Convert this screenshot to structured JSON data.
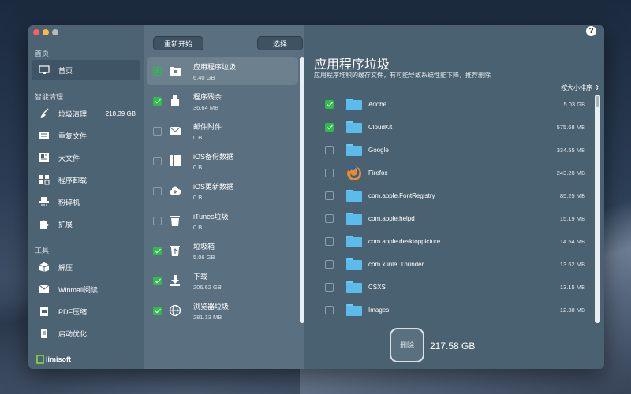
{
  "sidebar": {
    "section_home": "首页",
    "home": "首页",
    "section_smart": "智能清理",
    "items": [
      {
        "label": "垃圾清理",
        "size": "218.39 GB"
      },
      {
        "label": "重复文件"
      },
      {
        "label": "大文件"
      },
      {
        "label": "程序卸载"
      },
      {
        "label": "粉碎机"
      },
      {
        "label": "扩展"
      }
    ],
    "section_tools": "工具",
    "tools": [
      {
        "label": "解压"
      },
      {
        "label": "Winmail阅读"
      },
      {
        "label": "PDF压缩"
      },
      {
        "label": "启动优化"
      }
    ],
    "logo": "limisoft"
  },
  "toolbar": {
    "restart_label": "重新开始",
    "select_label": "选择"
  },
  "categories": [
    {
      "name": "应用程序垃圾",
      "size": "6.40 GB",
      "state": "partial"
    },
    {
      "name": "程序残余",
      "size": "36.64 MB",
      "state": "checked"
    },
    {
      "name": "邮件附件",
      "size": "0 B",
      "state": "unchecked"
    },
    {
      "name": "iOS备份数据",
      "size": "0 B",
      "state": "unchecked"
    },
    {
      "name": "iOS更新数据",
      "size": "0 B",
      "state": "unchecked"
    },
    {
      "name": "iTunes垃圾",
      "size": "0 B",
      "state": "unchecked"
    },
    {
      "name": "垃圾箱",
      "size": "5.06 GB",
      "state": "checked"
    },
    {
      "name": "下载",
      "size": "206.62 GB",
      "state": "checked"
    },
    {
      "name": "浏览器垃圾",
      "size": "281.13 MB",
      "state": "checked"
    }
  ],
  "detail": {
    "title": "应用程序垃圾",
    "description": "应用程序堆积的缓存文件，有可能导致系统性能下降，推荐删除",
    "sort_label": "按大小排序",
    "files": [
      {
        "name": "Adobe",
        "size": "5.03 GB",
        "checked": true,
        "icon": "folder-icon"
      },
      {
        "name": "CloudKit",
        "size": "575.68 MB",
        "checked": true,
        "icon": "folder-icon"
      },
      {
        "name": "Google",
        "size": "334.55 MB",
        "checked": false,
        "icon": "folder-icon"
      },
      {
        "name": "Firefox",
        "size": "243.20 MB",
        "checked": false,
        "icon": "firefox-icon"
      },
      {
        "name": "com.apple.FontRegistry",
        "size": "85.25 MB",
        "checked": false,
        "icon": "folder-icon"
      },
      {
        "name": "com.apple.helpd",
        "size": "15.19 MB",
        "checked": false,
        "icon": "folder-icon"
      },
      {
        "name": "com.apple.desktoppicture",
        "size": "14.54 MB",
        "checked": false,
        "icon": "folder-icon"
      },
      {
        "name": "com.xunlei.Thunder",
        "size": "13.62 MB",
        "checked": false,
        "icon": "folder-icon"
      },
      {
        "name": "CSXS",
        "size": "13.15 MB",
        "checked": false,
        "icon": "folder-icon"
      },
      {
        "name": "Images",
        "size": "12.38 MB",
        "checked": false,
        "icon": "folder-icon"
      }
    ],
    "delete_label": "删除",
    "total": "217.58 GB"
  },
  "help": "?"
}
